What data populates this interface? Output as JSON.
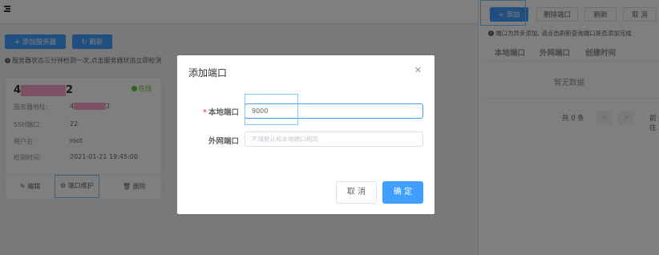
{
  "toolbar": {
    "add_server": "添加服务器",
    "refresh": "刷新"
  },
  "tip_text": "服务器状态三分钟检测一次,点击服务器状态立即检测",
  "server_card": {
    "title_suffix": "2",
    "title_prefix": "4",
    "status": "在线",
    "rows": [
      {
        "label": "服务器地址:",
        "value_prefix": "4",
        "value_suffix": "2"
      },
      {
        "label": "SSH端口:",
        "value": "22"
      },
      {
        "label": "用户名:",
        "value": "root"
      },
      {
        "label": "检测时间:",
        "value": "2021-01-21 19:45:00"
      }
    ],
    "actions": {
      "edit": "编辑",
      "port": "端口维护",
      "delete": "删除"
    }
  },
  "drawer": {
    "buttons": {
      "add": "添加",
      "delete_port": "删除端口",
      "refresh": "刷新",
      "cancel": "取 消"
    },
    "tip": "端口为异步添加, 请点击刷新查询端口是否添加完成",
    "columns": [
      "本地端口",
      "外网端口",
      "创建时间"
    ],
    "empty": "暂无数据",
    "pager": {
      "total": "共 0 条",
      "prev": "<",
      "next": ">",
      "goto": "前往"
    }
  },
  "modal": {
    "title": "添加端口",
    "local_port_label": "本地端口",
    "local_port_value": "9000",
    "external_port_label": "外网端口",
    "external_port_placeholder": "不填默认和本地端口相同",
    "cancel": "取 消",
    "confirm": "确 定"
  },
  "colors": {
    "primary": "#409eff",
    "success": "#67c23a",
    "highlight": "#80c8ff",
    "redaction": "#ff9ec7",
    "overlay": "rgba(0,0,0,0.5)"
  }
}
